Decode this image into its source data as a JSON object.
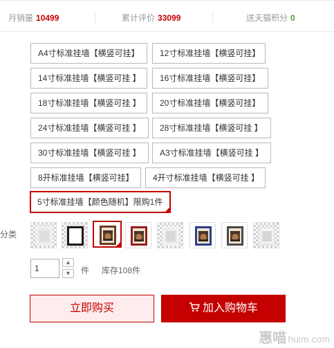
{
  "stats": {
    "monthly_sales_label": "月销量",
    "monthly_sales_value": "10499",
    "total_reviews_label": "累计评价",
    "total_reviews_value": "33099",
    "points_label": "送天猫积分",
    "points_value": "0"
  },
  "size_options": [
    "A4寸标准挂墙【横竖可挂】",
    "12寸标准挂墙【横竖可挂】",
    "14寸标准挂墙【横竖可挂 】",
    "16寸标准挂墙【横竖可挂】",
    "18寸标准挂墙【横竖可挂 】",
    "20寸标准挂墙【横竖可挂】",
    "24寸标准挂墙【横竖可挂 】",
    "28寸标准挂墙【横竖可挂 】",
    "30寸标准挂墙【横竖可挂 】",
    "A3寸标准挂墙【横竖可挂 】",
    "8开标准挂墙【横竖可挂】",
    "4开寸标准挂墙【横竖可挂 】",
    "5寸标准挂墙【颜色随机】限购1件"
  ],
  "selected_size_index": 12,
  "color_label": "分类",
  "color_thumbnails": [
    "frame-thumbnail",
    "frame-thumbnail",
    "frame-thumbnail-brown",
    "frame-thumbnail-red",
    "frame-thumbnail",
    "frame-thumbnail-blue",
    "frame-thumbnail",
    "frame-thumbnail"
  ],
  "selected_color_index": 2,
  "quantity": {
    "value": "1",
    "unit": "件",
    "stock": "库存108件"
  },
  "buttons": {
    "buy_now": "立即购买",
    "add_to_cart": "加入购物车"
  },
  "watermark": {
    "text": "惠喵",
    "domain": "huim.com"
  },
  "colors": {
    "accent": "#c40000",
    "points_green": "#4aa52e"
  }
}
